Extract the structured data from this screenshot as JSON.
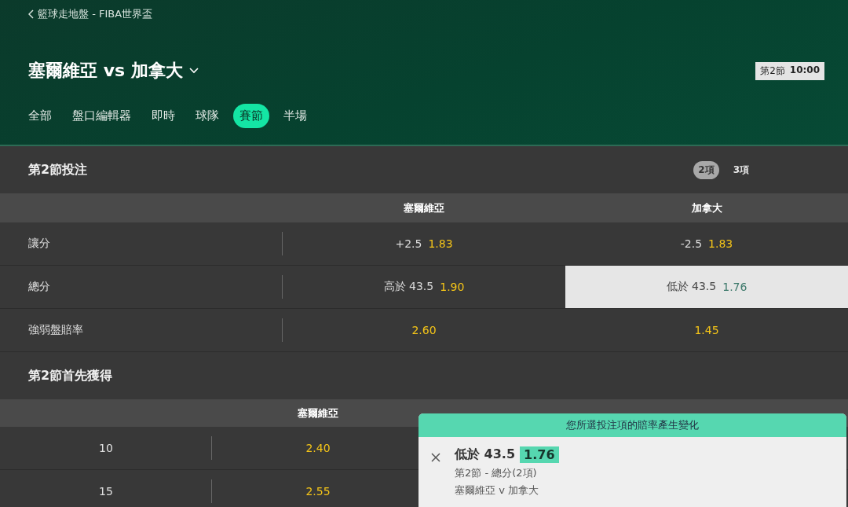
{
  "breadcrumb": "籃球走地盤 - FIBA世界盃",
  "match": {
    "title": "塞爾維亞 vs 加拿大",
    "period": "第2節",
    "time": "10:00"
  },
  "tabs": [
    {
      "label": "全部",
      "selected": false
    },
    {
      "label": "盤口編輯器",
      "selected": false
    },
    {
      "label": "即時",
      "selected": false
    },
    {
      "label": "球隊",
      "selected": false
    },
    {
      "label": "賽節",
      "selected": true
    },
    {
      "label": "半場",
      "selected": false
    }
  ],
  "sections": [
    {
      "kind": "markets",
      "title": "第2節投注",
      "toggle": [
        {
          "label": "2項",
          "selected": true
        },
        {
          "label": "3項",
          "selected": false
        }
      ],
      "columns": [
        "塞爾維亞",
        "加拿大"
      ],
      "rows": [
        {
          "label": "讓分",
          "cells": [
            {
              "line": "+2.5",
              "odds": "1.83",
              "selected": false
            },
            {
              "line": "-2.5",
              "odds": "1.83",
              "selected": false
            }
          ]
        },
        {
          "label": "總分",
          "cells": [
            {
              "line": "高於 43.5",
              "odds": "1.90",
              "selected": false
            },
            {
              "line": "低於 43.5",
              "odds": "1.76",
              "selected": true
            }
          ]
        },
        {
          "label": "強弱盤賠率",
          "cells": [
            {
              "odds": "2.60",
              "selected": false
            },
            {
              "odds": "1.45",
              "selected": false
            }
          ]
        }
      ]
    },
    {
      "kind": "race",
      "title": "第2節首先獲得",
      "columns": [
        "塞爾維亞"
      ],
      "rows": [
        {
          "label": "10",
          "cells": [
            {
              "odds": "2.40",
              "selected": false
            }
          ]
        },
        {
          "label": "15",
          "cells": [
            {
              "odds": "2.55",
              "selected": false
            }
          ]
        }
      ]
    }
  ],
  "notice": {
    "banner": "您所選投注項的賠率產生變化",
    "selection": "低於 43.5",
    "odds": "1.76",
    "market": "第2節 - 總分(2項)",
    "event": "塞爾維亞 v 加拿大"
  }
}
